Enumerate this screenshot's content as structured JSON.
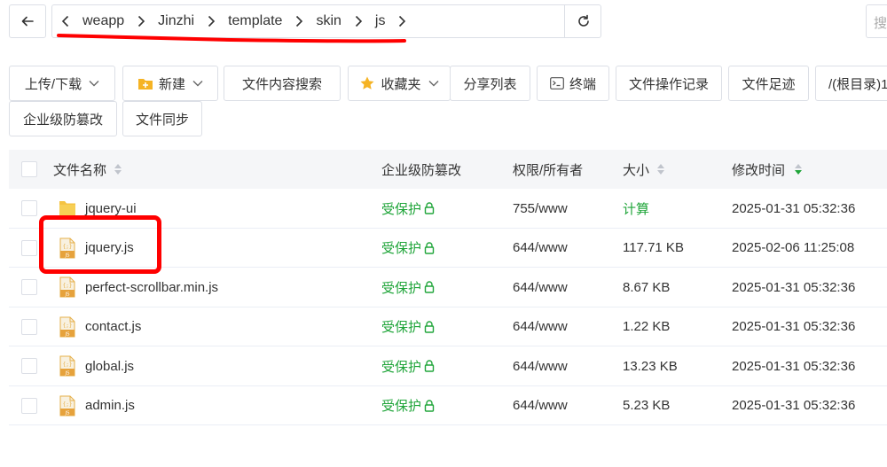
{
  "breadcrumb": [
    "weapp",
    "Jinzhi",
    "template",
    "skin",
    "js"
  ],
  "search": {
    "placeholder": "搜"
  },
  "toolbar": {
    "upload_download": "上传/下载",
    "new": "新建",
    "content_search": "文件内容搜索",
    "favorites": "收藏夹",
    "share_list": "分享列表",
    "terminal": "终端",
    "op_log": "文件操作记录",
    "footprint": "文件足迹",
    "root": "/(根目录)1",
    "tamper": "企业级防篡改",
    "sync": "文件同步"
  },
  "table": {
    "headers": {
      "name": "文件名称",
      "tamper": "企业级防篡改",
      "perm": "权限/所有者",
      "size": "大小",
      "mtime": "修改时间"
    },
    "rows": [
      {
        "name": "jquery-ui",
        "type": "folder",
        "tamper": "受保护",
        "perm": "755/www",
        "size": "计算",
        "mtime": "2025-01-31 05:32:36"
      },
      {
        "name": "jquery.js",
        "type": "js",
        "tamper": "受保护",
        "perm": "644/www",
        "size": "117.71 KB",
        "mtime": "2025-02-06 11:25:08"
      },
      {
        "name": "perfect-scrollbar.min.js",
        "type": "js",
        "tamper": "受保护",
        "perm": "644/www",
        "size": "8.67 KB",
        "mtime": "2025-01-31 05:32:36"
      },
      {
        "name": "contact.js",
        "type": "js",
        "tamper": "受保护",
        "perm": "644/www",
        "size": "1.22 KB",
        "mtime": "2025-01-31 05:32:36"
      },
      {
        "name": "global.js",
        "type": "js",
        "tamper": "受保护",
        "perm": "644/www",
        "size": "13.23 KB",
        "mtime": "2025-01-31 05:32:36"
      },
      {
        "name": "admin.js",
        "type": "js",
        "tamper": "受保护",
        "perm": "644/www",
        "size": "5.23 KB",
        "mtime": "2025-01-31 05:32:36"
      }
    ]
  },
  "colors": {
    "accent_green": "#20a53a",
    "annotation_red": "#ff0000"
  }
}
